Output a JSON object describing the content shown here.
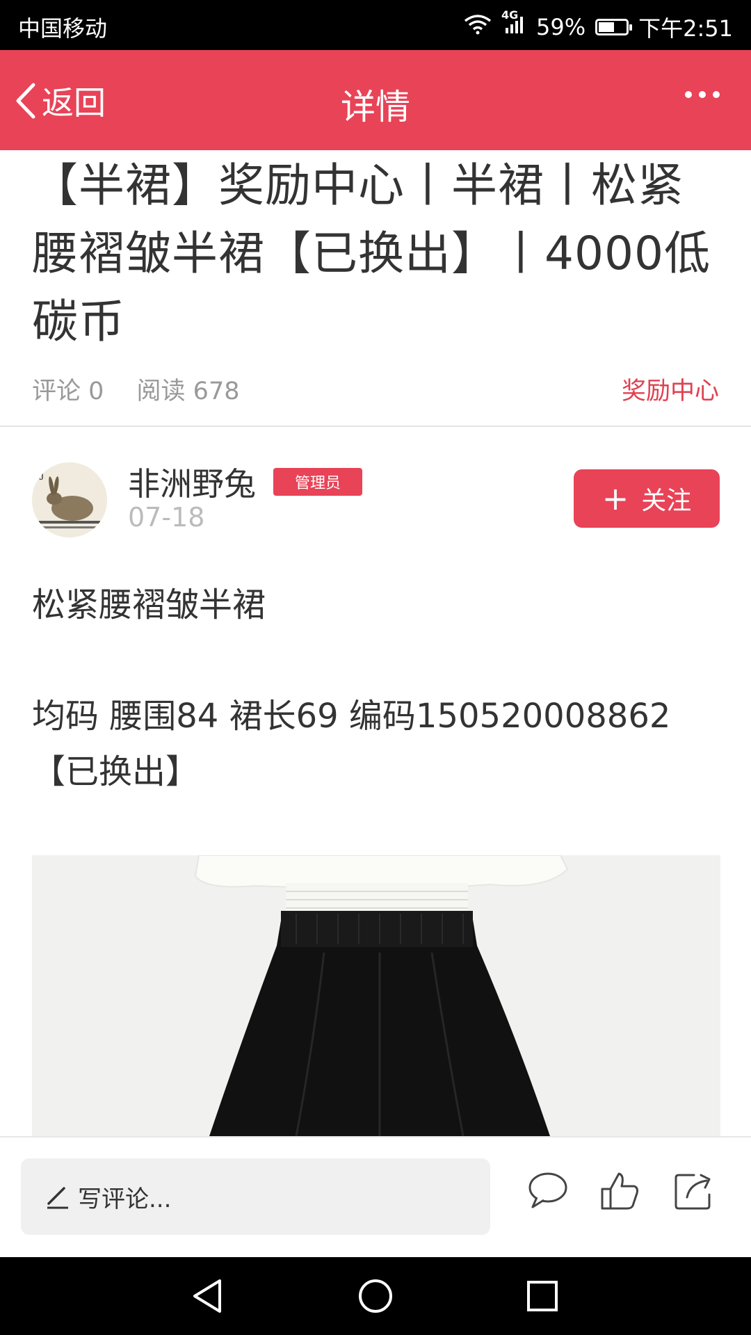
{
  "status_bar": {
    "carrier": "中国移动",
    "network": "4G",
    "battery_percent": "59%",
    "battery_level": 0.59,
    "time": "下午2:51"
  },
  "header": {
    "back_label": "返回",
    "title": "详情",
    "more_icon": "more-icon"
  },
  "article": {
    "title": "【半裙】奖励中心丨半裙丨松紧腰褶皱半裙【已换出】丨4000低碳币",
    "comments": "评论 0",
    "reads": "阅读 678",
    "category": "奖励中心"
  },
  "author": {
    "name": "非洲野兔",
    "badge": "管理员",
    "date": "07-18",
    "follow_label": "关注"
  },
  "content": {
    "line1": "松紧腰褶皱半裙",
    "line2": "均码  腰围84   裙长69   编码150520008862【已换出】"
  },
  "bottom_bar": {
    "comment_placeholder": "写评论...",
    "icons": [
      "comment-icon",
      "like-icon",
      "share-icon"
    ]
  },
  "nav_bar": {
    "icons": [
      "back-triangle-icon",
      "home-circle-icon",
      "recents-square-icon"
    ]
  },
  "colors": {
    "accent": "#e84357",
    "category_text": "#e04050"
  }
}
